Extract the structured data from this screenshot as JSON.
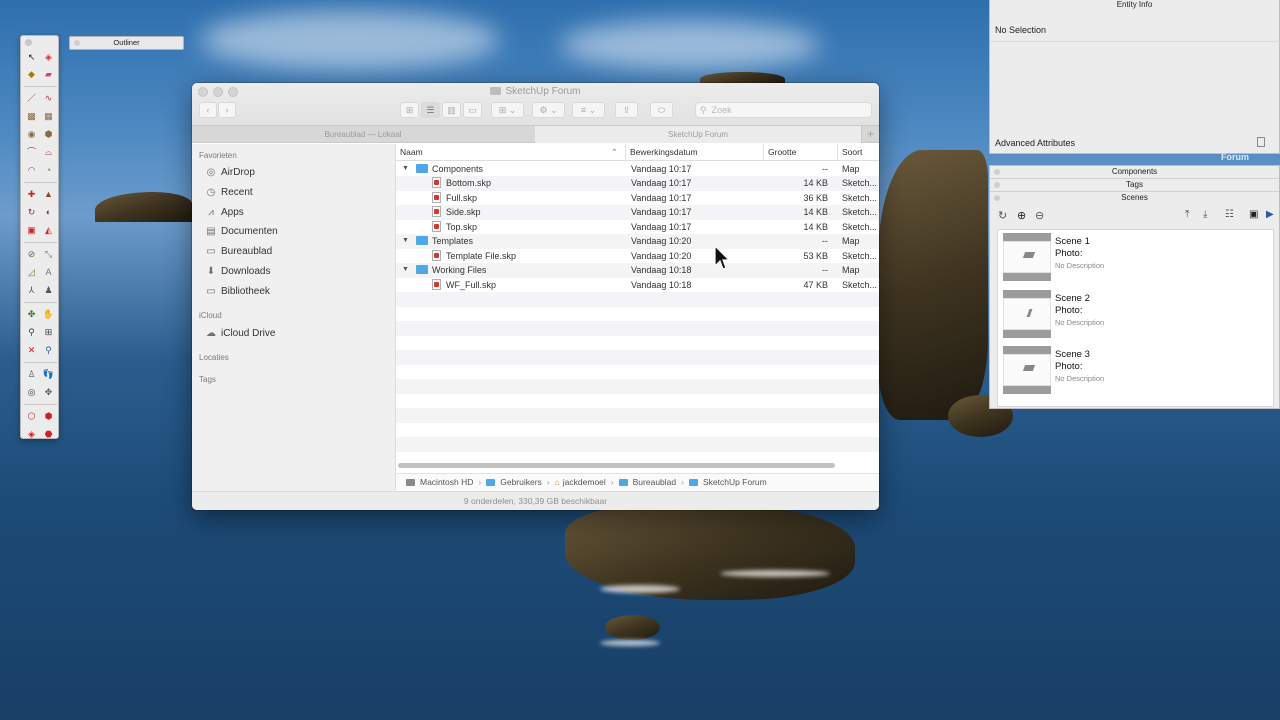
{
  "desktop": {
    "forum_label": "Forum"
  },
  "outliner": {
    "title": "Outliner"
  },
  "finder": {
    "title": "SketchUp Forum",
    "search_placeholder": "Zoek",
    "tabs": [
      {
        "label": "Bureaublad — Lokaal",
        "active": false
      },
      {
        "label": "SketchUp Forum",
        "active": true
      }
    ],
    "sidebar": {
      "favorites_heading": "Favorieten",
      "favorites": [
        {
          "label": "AirDrop",
          "icon": "airdrop-icon"
        },
        {
          "label": "Recent",
          "icon": "clock-icon"
        },
        {
          "label": "Apps",
          "icon": "apps-icon"
        },
        {
          "label": "Documenten",
          "icon": "document-icon"
        },
        {
          "label": "Bureaublad",
          "icon": "desktop-icon"
        },
        {
          "label": "Downloads",
          "icon": "download-icon"
        },
        {
          "label": "Bibliotheek",
          "icon": "folder-icon"
        }
      ],
      "icloud_heading": "iCloud",
      "icloud": [
        {
          "label": "iCloud Drive",
          "icon": "cloud-icon"
        }
      ],
      "locations_heading": "Locaties",
      "tags_heading": "Tags"
    },
    "columns": {
      "name": "Naam",
      "date": "Bewerkingsdatum",
      "size": "Grootte",
      "kind": "Soort"
    },
    "rows": [
      {
        "name": "Components",
        "date": "Vandaag 10:17",
        "size": "--",
        "kind": "Map",
        "type": "folder",
        "level": 0
      },
      {
        "name": "Bottom.skp",
        "date": "Vandaag 10:17",
        "size": "14 KB",
        "kind": "Sketch...",
        "type": "file",
        "level": 1
      },
      {
        "name": "Full.skp",
        "date": "Vandaag 10:17",
        "size": "36 KB",
        "kind": "Sketch...",
        "type": "file",
        "level": 1
      },
      {
        "name": "Side.skp",
        "date": "Vandaag 10:17",
        "size": "14 KB",
        "kind": "Sketch...",
        "type": "file",
        "level": 1
      },
      {
        "name": "Top.skp",
        "date": "Vandaag 10:17",
        "size": "14 KB",
        "kind": "Sketch...",
        "type": "file",
        "level": 1
      },
      {
        "name": "Templates",
        "date": "Vandaag 10:20",
        "size": "--",
        "kind": "Map",
        "type": "folder",
        "level": 0
      },
      {
        "name": "Template File.skp",
        "date": "Vandaag 10:20",
        "size": "53 KB",
        "kind": "Sketch...",
        "type": "file",
        "level": 1
      },
      {
        "name": "Working Files",
        "date": "Vandaag 10:18",
        "size": "--",
        "kind": "Map",
        "type": "folder",
        "level": 0
      },
      {
        "name": "WF_Full.skp",
        "date": "Vandaag 10:18",
        "size": "47 KB",
        "kind": "Sketch...",
        "type": "file",
        "level": 1
      }
    ],
    "path": [
      "Macintosh HD",
      "Gebruikers",
      "jackdemoel",
      "Bureaublad",
      "SketchUp Forum"
    ],
    "status": "9 onderdelen, 330,39 GB beschikbaar"
  },
  "entity_info": {
    "title": "Entity Info",
    "selection": "No Selection",
    "advanced": "Advanced Attributes"
  },
  "trays": {
    "components": "Components",
    "tags": "Tags",
    "scenes": "Scenes"
  },
  "scenes": [
    {
      "name": "Scene 1",
      "photo": "Photo:",
      "desc": "No Description"
    },
    {
      "name": "Scene 2",
      "photo": "Photo:",
      "desc": "No Description"
    },
    {
      "name": "Scene 3",
      "photo": "Photo:",
      "desc": "No Description"
    }
  ]
}
